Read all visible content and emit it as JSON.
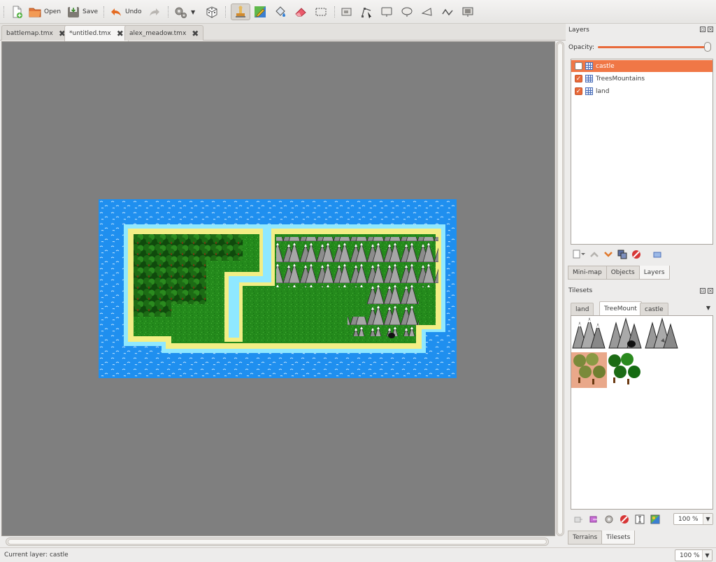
{
  "toolbar": {
    "open_label": "Open",
    "save_label": "Save",
    "undo_label": "Undo"
  },
  "tabs": [
    {
      "label": "battlemap.tmx",
      "active": false
    },
    {
      "label": "*untitled.tmx",
      "active": true
    },
    {
      "label": "alex_meadow.tmx",
      "active": false
    }
  ],
  "layers_panel": {
    "title": "Layers",
    "opacity_label": "Opacity:",
    "opacity_value": 1.0,
    "layers": [
      {
        "name": "castle",
        "visible": false,
        "selected": true
      },
      {
        "name": "TreesMountains",
        "visible": true,
        "selected": false
      },
      {
        "name": "land",
        "visible": true,
        "selected": false
      }
    ],
    "bottom_tabs": [
      "Mini-map",
      "Objects",
      "Layers"
    ],
    "active_bottom_tab": "Layers"
  },
  "tilesets_panel": {
    "title": "Tilesets",
    "tabs": [
      "land",
      "TreeMount",
      "castle"
    ],
    "active_tab": "TreeMount",
    "zoom": "100 %",
    "bottom_tabs": [
      "Terrains",
      "Tilesets"
    ],
    "active_bottom_tab": "Tilesets"
  },
  "status": {
    "current_layer": "Current layer: castle",
    "zoom": "100 %"
  },
  "colors": {
    "accent": "#f07746",
    "canvas_bg": "#7f7f7f",
    "water": "#1f8fef",
    "sand": "#f3ee85",
    "grass": "#248a1c"
  }
}
